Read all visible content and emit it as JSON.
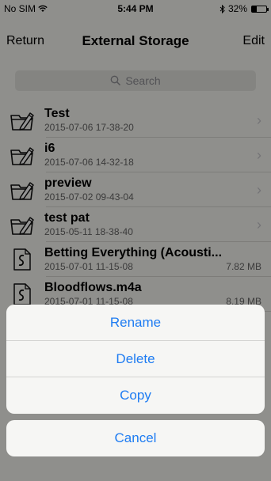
{
  "status": {
    "carrier": "No SIM",
    "time": "5:44 PM",
    "battery": "32%",
    "battery_level": 0.32
  },
  "nav": {
    "back_label": "Return",
    "title": "External Storage",
    "edit_label": "Edit"
  },
  "search": {
    "placeholder": "Search"
  },
  "files": [
    {
      "name": "Test",
      "date": "2015-07-06 17-38-20",
      "size": "",
      "type": "folder"
    },
    {
      "name": "i6",
      "date": "2015-07-06 14-32-18",
      "size": "",
      "type": "folder"
    },
    {
      "name": "preview",
      "date": "2015-07-02 09-43-04",
      "size": "",
      "type": "folder"
    },
    {
      "name": "test pat",
      "date": "2015-05-11 18-38-40",
      "size": "",
      "type": "folder"
    },
    {
      "name": "Betting Everything (Acousti...",
      "date": "2015-07-01 11-15-08",
      "size": "7.82 MB",
      "type": "audio"
    },
    {
      "name": "Bloodflows.m4a",
      "date": "2015-07-01 11-15-08",
      "size": "8.19 MB",
      "type": "audio"
    }
  ],
  "action_sheet": {
    "rename_label": "Rename",
    "delete_label": "Delete",
    "copy_label": "Copy",
    "cancel_label": "Cancel"
  },
  "colors": {
    "accent": "#1e7cf2",
    "background": "#f7f6f1"
  }
}
